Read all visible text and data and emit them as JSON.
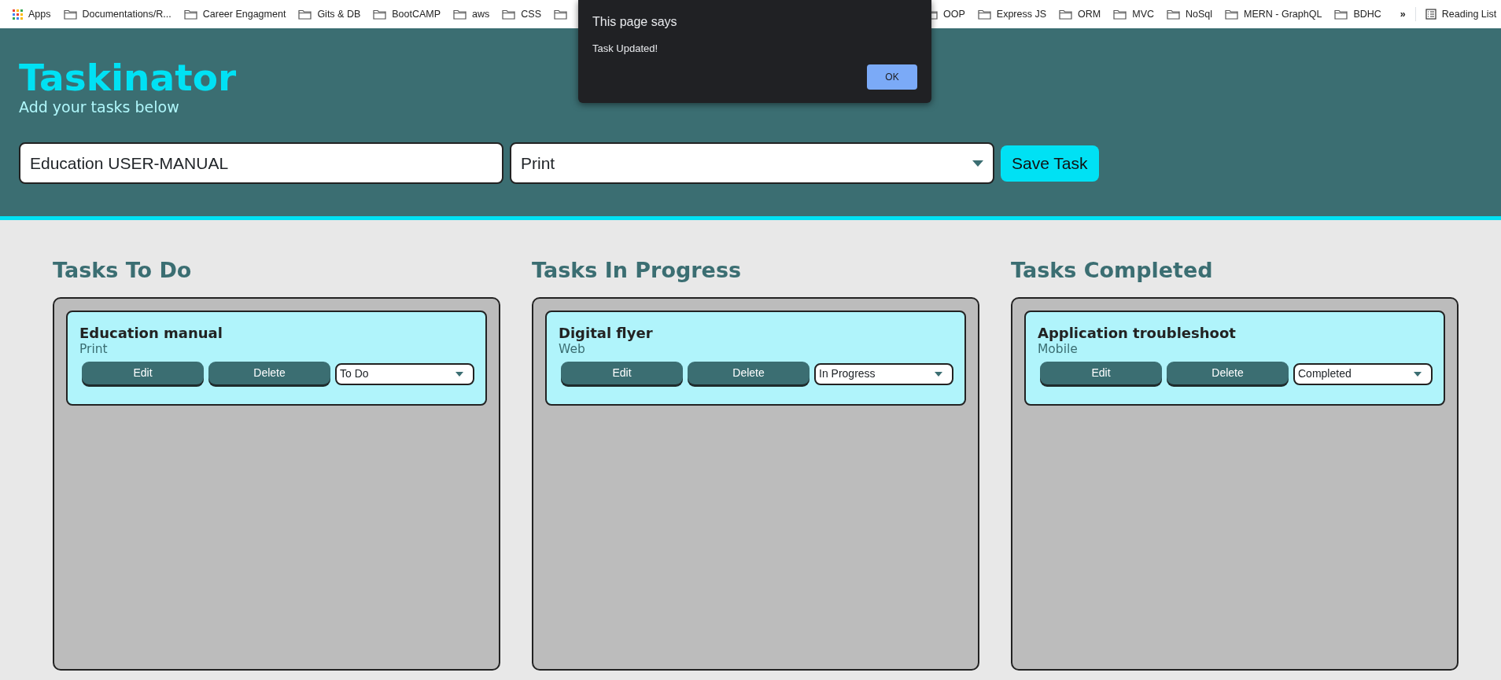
{
  "bookmarks_bar": {
    "apps": "Apps",
    "bookmarks_left": [
      "Documentations/R...",
      "Career Engagment",
      "Gits & DB",
      "BootCAMP",
      "aws",
      "CSS"
    ],
    "bookmarks_right": [
      "OOP",
      "Express JS",
      "ORM",
      "MVC",
      "NoSql",
      "MERN - GraphQL",
      "BDHC"
    ],
    "overflow": "»",
    "reading_list": "Reading List"
  },
  "alert_dialog": {
    "title": "This page says",
    "message": "Task Updated!",
    "button": "OK"
  },
  "header": {
    "title": "Taskinator",
    "subtitle": "Add your tasks below"
  },
  "task_form": {
    "name_value": "Education USER-MANUAL",
    "type_value": "Print",
    "button": "Save Task"
  },
  "columns": [
    {
      "title": "Tasks To Do",
      "tasks": [
        {
          "name": "Education manual",
          "type": "Print",
          "edit": "Edit",
          "delete": "Delete",
          "status": "To Do"
        }
      ]
    },
    {
      "title": "Tasks In Progress",
      "tasks": [
        {
          "name": "Digital flyer",
          "type": "Web",
          "edit": "Edit",
          "delete": "Delete",
          "status": "In Progress"
        }
      ]
    },
    {
      "title": "Tasks Completed",
      "tasks": [
        {
          "name": "Application troubleshoot",
          "type": "Mobile",
          "edit": "Edit",
          "delete": "Delete",
          "status": "Completed"
        }
      ]
    }
  ]
}
